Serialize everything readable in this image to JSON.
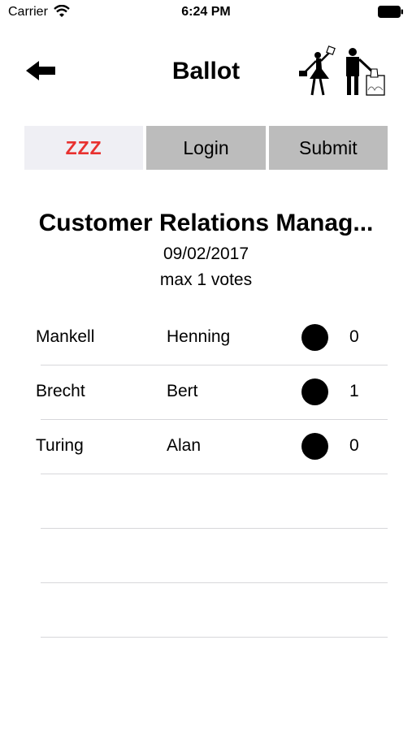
{
  "status_bar": {
    "carrier": "Carrier",
    "time": "6:24 PM"
  },
  "nav": {
    "title": "Ballot"
  },
  "segments": {
    "zzz": "ZZZ",
    "login": "Login",
    "submit": "Submit"
  },
  "ballot": {
    "title": "Customer Relations Manag...",
    "date": "09/02/2017",
    "max": "max 1 votes"
  },
  "candidates": [
    {
      "last": "Mankell",
      "first": "Henning",
      "votes": "0"
    },
    {
      "last": "Brecht",
      "first": "Bert",
      "votes": "1"
    },
    {
      "last": "Turing",
      "first": "Alan",
      "votes": "0"
    }
  ],
  "colors": {
    "zzz_text": "#e8312f",
    "segment_bg": "#bcbcbc",
    "segment_active_bg": "#efeff4"
  }
}
